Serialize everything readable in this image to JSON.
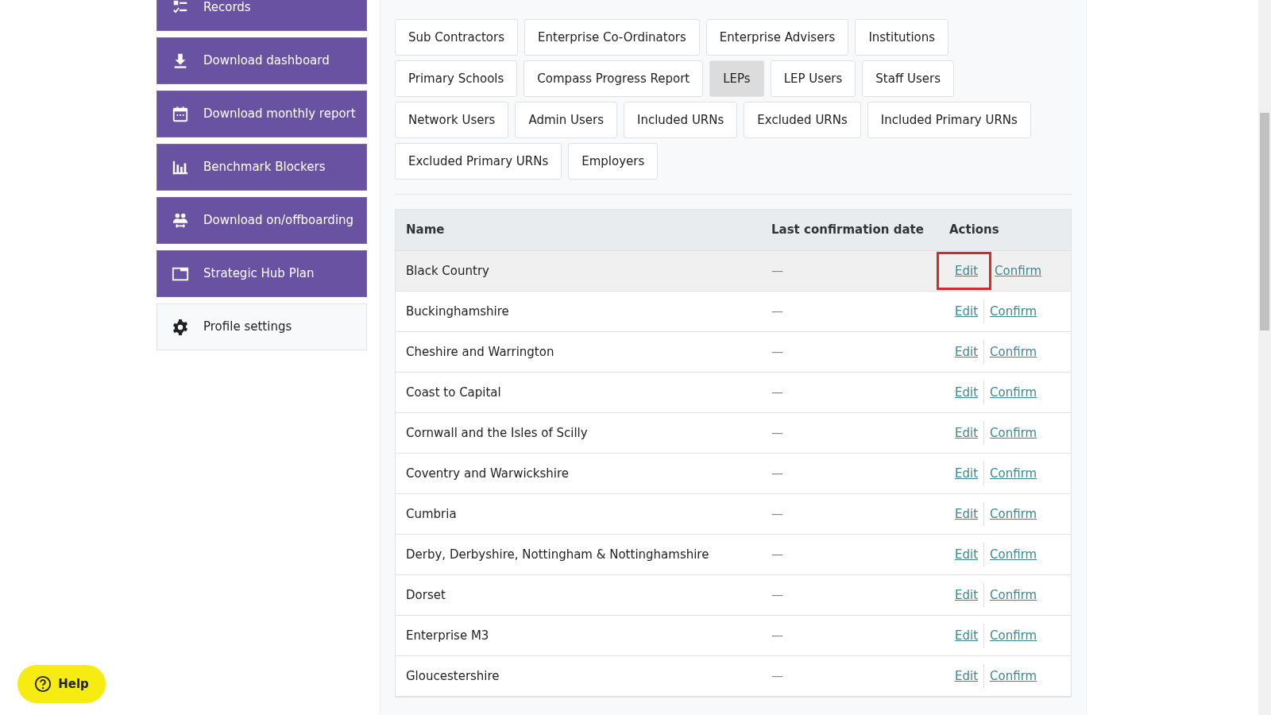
{
  "sidebar": {
    "items": [
      {
        "label": "Records",
        "kind": "primary"
      },
      {
        "label": "Download dashboard",
        "kind": "primary"
      },
      {
        "label": "Download monthly report",
        "kind": "primary"
      },
      {
        "label": "Benchmark Blockers",
        "kind": "primary"
      },
      {
        "label": "Download on/offboarding",
        "kind": "primary"
      },
      {
        "label": "Strategic Hub Plan",
        "kind": "primary"
      },
      {
        "label": "Profile settings",
        "kind": "light"
      }
    ]
  },
  "record_tabs": [
    [
      {
        "label": "Sub Contractors",
        "selected": false
      },
      {
        "label": "Enterprise Co-Ordinators",
        "selected": false
      },
      {
        "label": "Enterprise Advisers",
        "selected": false
      },
      {
        "label": "Institutions",
        "selected": false
      }
    ],
    [
      {
        "label": "Primary Schools",
        "selected": false
      },
      {
        "label": "Compass Progress Report",
        "selected": false
      },
      {
        "label": "LEPs",
        "selected": true
      },
      {
        "label": "LEP Users",
        "selected": false
      },
      {
        "label": "Staff Users",
        "selected": false
      }
    ],
    [
      {
        "label": "Network Users",
        "selected": false
      },
      {
        "label": "Admin Users",
        "selected": false
      },
      {
        "label": "Included URNs",
        "selected": false
      },
      {
        "label": "Excluded URNs",
        "selected": false
      },
      {
        "label": "Included Primary URNs",
        "selected": false
      }
    ],
    [
      {
        "label": "Excluded Primary URNs",
        "selected": false
      },
      {
        "label": "Employers",
        "selected": false
      }
    ]
  ],
  "table": {
    "columns": [
      "Name",
      "Last confirmation date",
      "Actions"
    ],
    "rows": [
      {
        "name": "Black Country",
        "date": "—",
        "edit": "Edit",
        "confirm": "Confirm",
        "selected": true,
        "highlighted": true
      },
      {
        "name": "Buckinghamshire",
        "date": "—",
        "edit": "Edit",
        "confirm": "Confirm",
        "selected": false,
        "highlighted": false
      },
      {
        "name": "Cheshire and Warrington",
        "date": "—",
        "edit": "Edit",
        "confirm": "Confirm",
        "selected": false,
        "highlighted": false
      },
      {
        "name": "Coast to Capital",
        "date": "—",
        "edit": "Edit",
        "confirm": "Confirm",
        "selected": false,
        "highlighted": false
      },
      {
        "name": "Cornwall and the Isles of Scilly",
        "date": "—",
        "edit": "Edit",
        "confirm": "Confirm",
        "selected": false,
        "highlighted": false
      },
      {
        "name": "Coventry and Warwickshire",
        "date": "—",
        "edit": "Edit",
        "confirm": "Confirm",
        "selected": false,
        "highlighted": false
      },
      {
        "name": "Cumbria",
        "date": "—",
        "edit": "Edit",
        "confirm": "Confirm",
        "selected": false,
        "highlighted": false
      },
      {
        "name": "Derby, Derbyshire, Nottingham & Nottinghamshire",
        "date": "—",
        "edit": "Edit",
        "confirm": "Confirm",
        "selected": false,
        "highlighted": false
      },
      {
        "name": "Dorset",
        "date": "—",
        "edit": "Edit",
        "confirm": "Confirm",
        "selected": false,
        "highlighted": false
      },
      {
        "name": "Enterprise M3",
        "date": "—",
        "edit": "Edit",
        "confirm": "Confirm",
        "selected": false,
        "highlighted": false
      },
      {
        "name": "Gloucestershire",
        "date": "—",
        "edit": "Edit",
        "confirm": "Confirm",
        "selected": false,
        "highlighted": false
      }
    ]
  },
  "help_button": {
    "label": "Help"
  }
}
